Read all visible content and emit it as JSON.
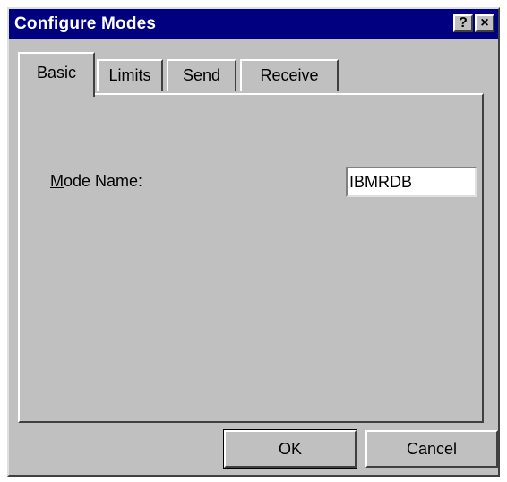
{
  "window": {
    "title": "Configure Modes",
    "help_glyph": "?",
    "close_glyph": "×"
  },
  "tabs": [
    {
      "label": "Basic",
      "active": true
    },
    {
      "label": "Limits",
      "active": false
    },
    {
      "label": "Send",
      "active": false
    },
    {
      "label": "Receive",
      "active": false
    }
  ],
  "basic": {
    "mode_name_label_mnemonic": "M",
    "mode_name_label_rest": "ode Name:",
    "mode_name_value": "IBMRDB"
  },
  "buttons": {
    "ok": "OK",
    "cancel": "Cancel"
  }
}
